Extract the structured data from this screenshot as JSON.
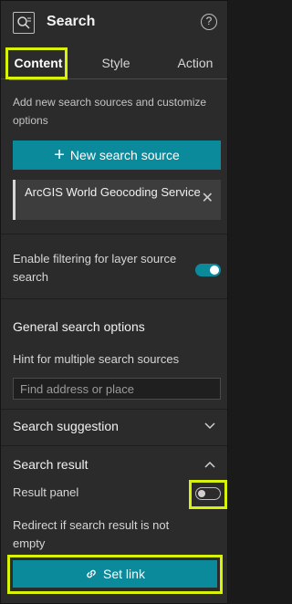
{
  "header": {
    "title": "Search",
    "app_icon": "search-widget-icon",
    "help_icon": "help-icon"
  },
  "tabs": [
    {
      "label": "Content",
      "active": true
    },
    {
      "label": "Style",
      "active": false
    },
    {
      "label": "Action",
      "active": false
    }
  ],
  "content": {
    "description": "Add new search sources and customize options",
    "new_source_label": "New search source",
    "sources": [
      {
        "label": "ArcGIS World Geocoding Service"
      }
    ],
    "filtering": {
      "label": "Enable filtering for layer source search",
      "enabled": true
    }
  },
  "general_options": {
    "title": "General search options",
    "hint_label": "Hint for multiple search sources",
    "hint_placeholder": "Find address or place"
  },
  "suggestion": {
    "title": "Search suggestion",
    "expanded": false
  },
  "result": {
    "title": "Search result",
    "expanded": true,
    "result_panel_label": "Result panel",
    "result_panel_enabled": false,
    "redirect_label": "Redirect if search result is not empty",
    "set_link_label": "Set link"
  },
  "colors": {
    "accent": "#0b8a9c",
    "highlight": "#d9f20a",
    "panel_bg": "#2b2b2b"
  }
}
